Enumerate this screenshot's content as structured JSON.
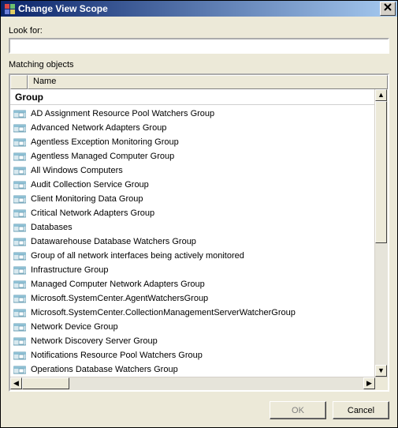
{
  "window": {
    "title": "Change View Scope"
  },
  "lookfor": {
    "label": "Look for:",
    "value": ""
  },
  "matching": {
    "label": "Matching objects"
  },
  "header": {
    "name": "Name"
  },
  "group_label": "Group",
  "items": [
    "AD Assignment Resource Pool Watchers Group",
    "Advanced Network Adapters Group",
    "Agentless Exception Monitoring Group",
    "Agentless Managed Computer Group",
    "All Windows Computers",
    "Audit Collection Service Group",
    "Client Monitoring Data Group",
    "Critical Network Adapters Group",
    "Databases",
    "Datawarehouse Database Watchers Group",
    "Group of all network interfaces being actively monitored",
    "Infrastructure Group",
    "Managed Computer Network Adapters Group",
    "Microsoft.SystemCenter.AgentWatchersGroup",
    "Microsoft.SystemCenter.CollectionManagementServerWatcherGroup",
    "Network Device Group",
    "Network Discovery Server Group",
    "Notifications Resource Pool Watchers Group",
    "Operations Database Watchers Group"
  ],
  "buttons": {
    "ok": "OK",
    "cancel": "Cancel"
  },
  "scroll": {
    "up": "▲",
    "down": "▼",
    "left": "◀",
    "right": "▶"
  }
}
